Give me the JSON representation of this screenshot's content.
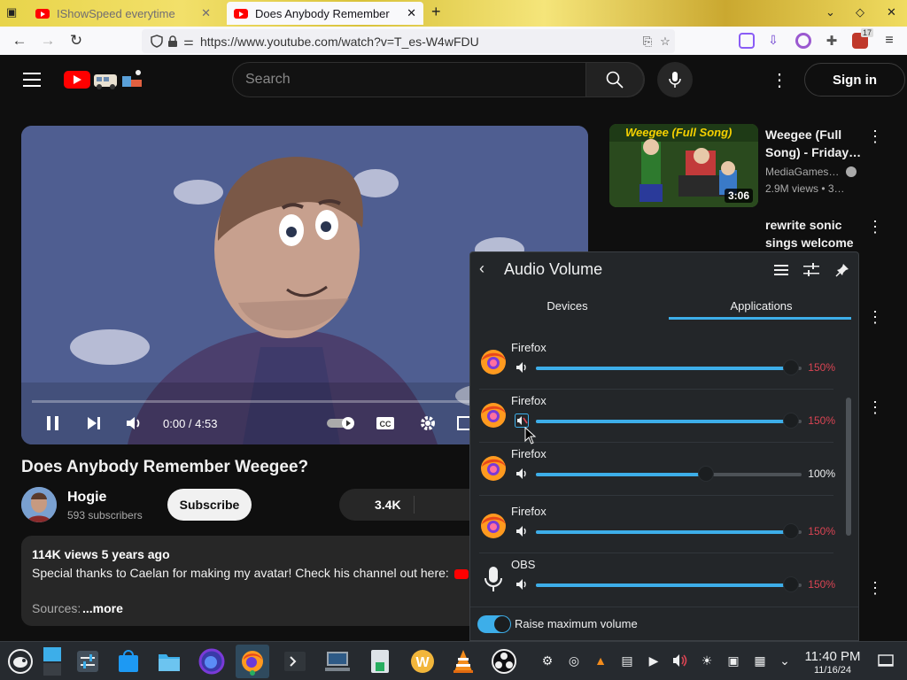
{
  "browser": {
    "tabs": [
      {
        "title": "IShowSpeed everytime"
      },
      {
        "title": "Does Anybody Remember"
      }
    ],
    "url": "https://www.youtube.com/watch?v=T_es-W4wFDU",
    "ext_badge": "17"
  },
  "youtube": {
    "search_placeholder": "Search",
    "signin_label": "Sign in",
    "player": {
      "time": "0:00 / 4:53",
      "progress": 0
    },
    "video_title": "Does Anybody Remember Weegee?",
    "channel": {
      "name": "Hogie",
      "subscribers": "593 subscribers"
    },
    "subscribe_label": "Subscribe",
    "likes": "3.4K",
    "description": {
      "stats": "114K views  5 years ago",
      "text": "Special thanks to Caelan for making my avatar! Check his channel out here:",
      "sources": "Sources:",
      "more": "...more"
    },
    "related": [
      {
        "thumb_caption": "Weegee (Full Song)",
        "duration": "3:06",
        "title": "Weegee (Full Song) - Friday…",
        "channel": "MediaGames…",
        "meta": "2.9M views  • 3…"
      },
      {
        "title": "rewrite sonic sings welcome t…"
      }
    ]
  },
  "audio_popup": {
    "title": "Audio Volume",
    "tabs": [
      {
        "label": "Devices"
      },
      {
        "label": "Applications"
      }
    ],
    "apps": [
      {
        "name": "Firefox",
        "volume": 150,
        "volume_text": "150%",
        "over": true,
        "icon": "firefox-icon",
        "speaker": "speaker-icon"
      },
      {
        "name": "Firefox",
        "volume": 150,
        "volume_text": "150%",
        "over": true,
        "icon": "firefox-icon",
        "speaker": "speaker-muted-icon"
      },
      {
        "name": "Firefox",
        "volume": 100,
        "volume_text": "100%",
        "over": false,
        "icon": "firefox-icon",
        "speaker": "speaker-icon"
      },
      {
        "name": "Firefox",
        "volume": 150,
        "volume_text": "150%",
        "over": true,
        "icon": "firefox-icon",
        "speaker": "speaker-icon"
      },
      {
        "name": "OBS",
        "volume": 150,
        "volume_text": "150%",
        "over": true,
        "icon": "microphone-icon",
        "speaker": "speaker-icon"
      }
    ],
    "max_volume": 150,
    "raise_label": "Raise maximum volume",
    "raise_enabled": true
  },
  "taskbar": {
    "time": "11:40 PM",
    "date": "11/16/24"
  },
  "colors": {
    "accent": "#3daee9",
    "over_volume": "#da4453",
    "youtube_red": "#ff0000"
  }
}
